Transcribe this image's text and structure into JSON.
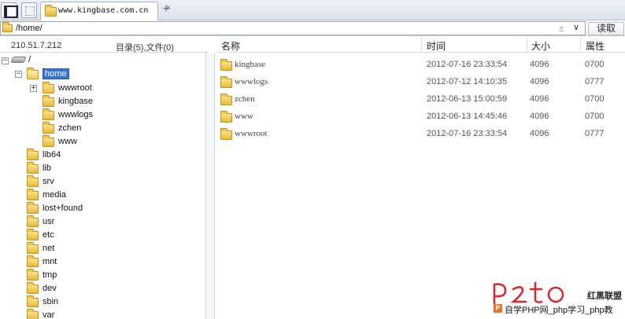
{
  "tabbar": {
    "tab_title": "www.kingbase.com.cn",
    "close_glyph": "×",
    "new_tab_glyph": "+"
  },
  "address": {
    "path": "/home/",
    "star_glyph": "±",
    "dropdown_glyph": "∨",
    "read_label": "读取"
  },
  "left": {
    "server_ip": "210.51.7.212",
    "dir_count": "目录(5),文件(0)",
    "root_label": "/",
    "tree": [
      {
        "label": "home"
      },
      {
        "label": "wwwroot"
      },
      {
        "label": "kingbase"
      },
      {
        "label": "wwwlogs"
      },
      {
        "label": "zchen"
      },
      {
        "label": "www"
      },
      {
        "label": "lib64"
      },
      {
        "label": "lib"
      },
      {
        "label": "srv"
      },
      {
        "label": "media"
      },
      {
        "label": "lost+found"
      },
      {
        "label": "usr"
      },
      {
        "label": "etc"
      },
      {
        "label": "net"
      },
      {
        "label": "mnt"
      },
      {
        "label": "tmp"
      },
      {
        "label": "dev"
      },
      {
        "label": "sbin"
      },
      {
        "label": "var"
      }
    ]
  },
  "list": {
    "headers": {
      "name": "名称",
      "time": "时间",
      "size": "大小",
      "attr": "属性"
    },
    "rows": [
      {
        "name": "kingbase",
        "time": "2012-07-16 23:33:54",
        "size": "4096",
        "attr": "0700"
      },
      {
        "name": "wwwlogs",
        "time": "2012-07-12 14:10:35",
        "size": "4096",
        "attr": "0777"
      },
      {
        "name": "zchen",
        "time": "2012-06-13 15:00:59",
        "size": "4096",
        "attr": "0700"
      },
      {
        "name": "www",
        "time": "2012-06-13 14:45:46",
        "size": "4096",
        "attr": "0700"
      },
      {
        "name": "wwwroot",
        "time": "2012-07-16 23:33:54",
        "size": "4096",
        "attr": "0777"
      }
    ]
  },
  "watermark": {
    "tag": "红黑联盟",
    "badge": "P",
    "line": "自学PHP网_php学习_php教"
  },
  "colors": {
    "selection": "#3875d7",
    "folder": "#f0c94c",
    "watermark_red": "#d8262c"
  }
}
